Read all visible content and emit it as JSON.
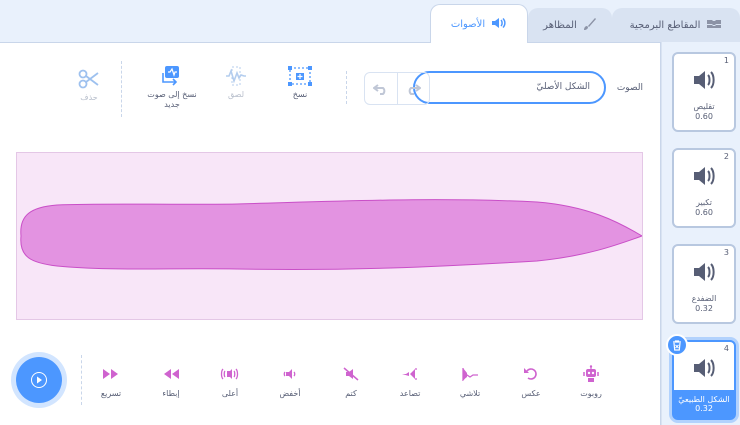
{
  "tabs": {
    "code": "المقاطع البرمجية",
    "costumes": "المظاهر",
    "sounds": "الأصوات"
  },
  "editor": {
    "sound_label": "الصوت",
    "sound_name": "الشكل الأصليّ",
    "tools": {
      "copy": "نسخ",
      "paste": "لصق",
      "copy_to_new": "نسخ إلى صوت جديد",
      "delete": "حذف"
    },
    "effects": [
      {
        "label": "تسريع",
        "icon": "faster-icon"
      },
      {
        "label": "إبطاء",
        "icon": "slower-icon"
      },
      {
        "label": "أعلى",
        "icon": "louder-icon"
      },
      {
        "label": "أخفض",
        "icon": "softer-icon"
      },
      {
        "label": "كتم",
        "icon": "mute-icon"
      },
      {
        "label": "تصاعد",
        "icon": "fade-in-icon"
      },
      {
        "label": "تلاشي",
        "icon": "fade-out-icon"
      },
      {
        "label": "عكس",
        "icon": "reverse-icon"
      },
      {
        "label": "روبوت",
        "icon": "robot-icon"
      }
    ]
  },
  "sounds": [
    {
      "index": "1",
      "name": "تقليص",
      "length": "0.60"
    },
    {
      "index": "2",
      "name": "تكبير",
      "length": "0.60"
    },
    {
      "index": "3",
      "name": "الضفدع",
      "length": "0.32"
    },
    {
      "index": "4",
      "name": "الشكل الطبيعيّ",
      "length": "0.32"
    }
  ],
  "colors": {
    "accent": "#4c97ff",
    "sound_purple": "#cf63cf",
    "wave_fill": "#e393e1",
    "wave_bg": "#f8e6f8"
  }
}
